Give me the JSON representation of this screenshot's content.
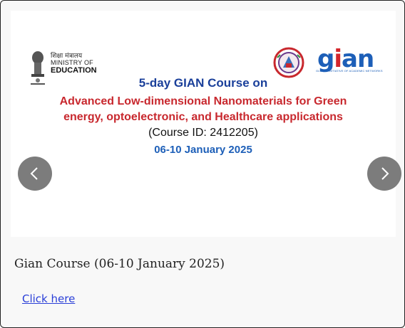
{
  "banner": {
    "ministry_hindi": "शिक्षा मंत्रालय",
    "ministry_line1": "MINISTRY OF",
    "ministry_line2": "EDUCATION",
    "gian_logo": "gian",
    "gian_tagline": "Global Initiative of Academic Networks",
    "heading": "5-day GIAN Course on",
    "title_line1": "Advanced Low-dimensional Nanomaterials for Green",
    "title_line2": "energy, optoelectronic, and Healthcare applications",
    "course_id": "(Course ID: 2412205)",
    "dates": "06-10 January 2025"
  },
  "carousel": {
    "prev_icon": "chevron-left-icon",
    "next_icon": "chevron-right-icon",
    "caption": "Gian Course (06-10 January 2025)",
    "link_label": "Click here"
  },
  "colors": {
    "heading_blue": "#1a3f9a",
    "title_red": "#c8282e",
    "date_blue": "#1d5fb8",
    "link_blue": "#2a3fd8",
    "nav_button": "#6e6e6e"
  }
}
